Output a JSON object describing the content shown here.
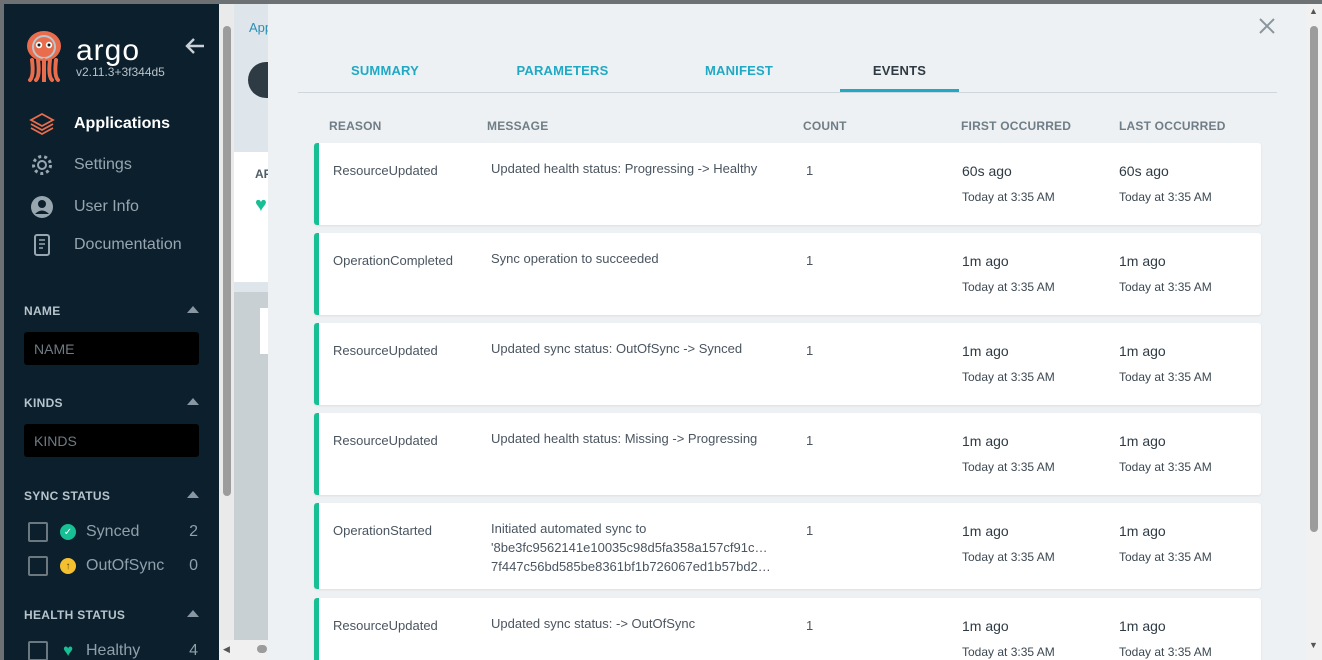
{
  "sidebar": {
    "brand": "argo",
    "version": "v2.11.3+3f344d5",
    "nav": [
      {
        "label": "Applications",
        "icon": "layers-icon"
      },
      {
        "label": "Settings",
        "icon": "gear-icon"
      },
      {
        "label": "User Info",
        "icon": "user-icon"
      },
      {
        "label": "Documentation",
        "icon": "book-icon"
      }
    ],
    "filters": {
      "name_title": "NAME",
      "name_placeholder": "NAME",
      "kinds_title": "KINDS",
      "kinds_placeholder": "KINDS",
      "sync_title": "SYNC STATUS",
      "sync_items": [
        {
          "label": "Synced",
          "count": "2",
          "color": "#18be94",
          "icon": "check-circle-icon"
        },
        {
          "label": "OutOfSync",
          "count": "0",
          "color": "#f4c030",
          "icon": "arrow-up-circle-icon"
        }
      ],
      "health_title": "HEALTH STATUS",
      "health_items": [
        {
          "label": "Healthy",
          "count": "4",
          "color": "#18be94",
          "icon": "heart-icon"
        }
      ]
    }
  },
  "background": {
    "breadcrumb": "Applic",
    "section_label": "AP"
  },
  "panel": {
    "tabs": [
      {
        "label": "SUMMARY",
        "active": false
      },
      {
        "label": "PARAMETERS",
        "active": false
      },
      {
        "label": "MANIFEST",
        "active": false
      },
      {
        "label": "EVENTS",
        "active": true
      }
    ],
    "columns": [
      "REASON",
      "MESSAGE",
      "COUNT",
      "FIRST OCCURRED",
      "LAST OCCURRED"
    ],
    "events": [
      {
        "reason": "ResourceUpdated",
        "message": [
          "Updated health status: Progressing -> Healthy"
        ],
        "count": "1",
        "first_rel": "60s ago",
        "first_abs": "Today at 3:35 AM",
        "last_rel": "60s ago",
        "last_abs": "Today at 3:35 AM"
      },
      {
        "reason": "OperationCompleted",
        "message": [
          "Sync operation to succeeded"
        ],
        "count": "1",
        "first_rel": "1m ago",
        "first_abs": "Today at 3:35 AM",
        "last_rel": "1m ago",
        "last_abs": "Today at 3:35 AM"
      },
      {
        "reason": "ResourceUpdated",
        "message": [
          "Updated sync status: OutOfSync -> Synced"
        ],
        "count": "1",
        "first_rel": "1m ago",
        "first_abs": "Today at 3:35 AM",
        "last_rel": "1m ago",
        "last_abs": "Today at 3:35 AM"
      },
      {
        "reason": "ResourceUpdated",
        "message": [
          "Updated health status: Missing -> Progressing"
        ],
        "count": "1",
        "first_rel": "1m ago",
        "first_abs": "Today at 3:35 AM",
        "last_rel": "1m ago",
        "last_abs": "Today at 3:35 AM"
      },
      {
        "reason": "OperationStarted",
        "message": [
          "Initiated automated sync to",
          "'8be3fc9562141e10035c98d5fa358a157cf91c…",
          "7f447c56bd585be8361bf1b726067ed1b57bd2…"
        ],
        "count": "1",
        "first_rel": "1m ago",
        "first_abs": "Today at 3:35 AM",
        "last_rel": "1m ago",
        "last_abs": "Today at 3:35 AM"
      },
      {
        "reason": "ResourceUpdated",
        "message": [
          "Updated sync status: -> OutOfSync"
        ],
        "count": "1",
        "first_rel": "1m ago",
        "first_abs": "Today at 3:35 AM",
        "last_rel": "1m ago",
        "last_abs": "Today at 3:35 AM"
      }
    ]
  },
  "colors": {
    "sidebar_bg": "#0b1f2c",
    "accent": "#20a9c4",
    "healthy": "#18be94",
    "outofsync": "#f4c030"
  }
}
